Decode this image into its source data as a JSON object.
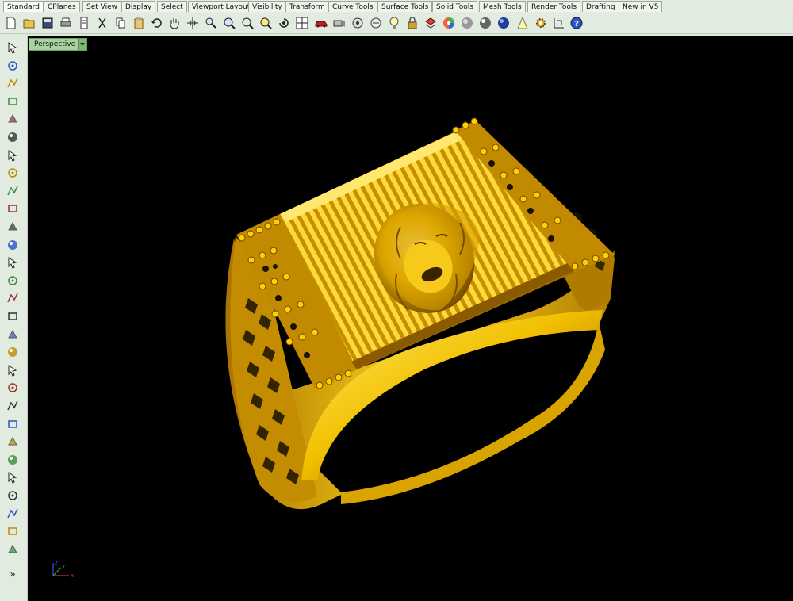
{
  "tabs": [
    {
      "label": "Standard",
      "active": true
    },
    {
      "label": "CPlanes"
    },
    {
      "label": "Set View"
    },
    {
      "label": "Display"
    },
    {
      "label": "Select"
    },
    {
      "label": "Viewport Layout"
    },
    {
      "label": "Visibility"
    },
    {
      "label": "Transform"
    },
    {
      "label": "Curve Tools"
    },
    {
      "label": "Surface Tools"
    },
    {
      "label": "Solid Tools"
    },
    {
      "label": "Mesh Tools"
    },
    {
      "label": "Render Tools"
    },
    {
      "label": "Drafting"
    },
    {
      "label": "New in V5"
    }
  ],
  "toolbar": {
    "icons": [
      "new-icon",
      "open-icon",
      "save-icon",
      "print-icon",
      "import-icon",
      "cut-icon",
      "copy-icon",
      "paste-icon",
      "undo-icon",
      "pan-hand-icon",
      "rotate-view-icon",
      "zoom-icon",
      "zoom-window-icon",
      "zoom-extents-icon",
      "zoom-selected-icon",
      "rotate-camera-icon",
      "four-viewports-icon",
      "car-icon",
      "camera-icon",
      "named-view-icon",
      "light-bulb-icon",
      "lock-icon",
      "layer-icon",
      "color-wheel-icon",
      "sphere-shaded-icon",
      "sphere-render-icon",
      "sphere-blue-icon",
      "light-cone-icon",
      "gear-options-icon",
      "grid-snap-icon",
      "help-icon"
    ]
  },
  "left_toolbar": {
    "icons": [
      "select-arrow-icon",
      "point-icon",
      "polyline-icon",
      "curve-icon",
      "circle-icon",
      "ellipse-icon",
      "polygon-icon",
      "rectangle-icon",
      "circle-tool-icon",
      "fillet-icon",
      "transform-icon",
      "surface-icon",
      "box-icon",
      "boolean-icon",
      "extrude-icon",
      "plane-icon",
      "edit-points-icon",
      "move-icon",
      "dimension-icon",
      "mirror-icon",
      "group-icon",
      "spheres-icon",
      "curve-arrow-icon",
      "blend-icon",
      "text-icon",
      "scale-icon",
      "array-icon",
      "rebuild-icon",
      "render-box-icon"
    ],
    "more_label": "»"
  },
  "viewport": {
    "title": "Perspective",
    "axes": {
      "x": "x",
      "y": "y",
      "z": "z"
    }
  },
  "colors": {
    "background": "#000000",
    "gold_light": "#ffe45a",
    "gold_mid": "#e0a800",
    "gold_dark": "#8a5a00",
    "viewport_tab": "#a7d39e"
  }
}
